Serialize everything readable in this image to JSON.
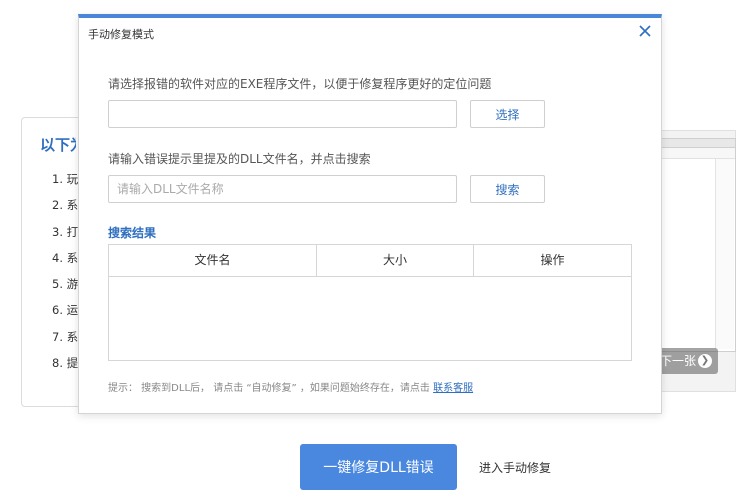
{
  "background": {
    "card_title": "以下为",
    "list_items": [
      "1. 玩",
      "2. 系",
      "3. 打",
      "4. 系",
      "5. 游",
      "6. 运",
      "7. 系",
      "8. 提"
    ],
    "next_button": "下一张",
    "primary_button": "一键修复DLL错误",
    "manual_link": "进入手动修复"
  },
  "modal": {
    "title": "手动修复模式",
    "exe_label": "请选择报错的软件对应的EXE程序文件，以便于修复程序更好的定位问题",
    "exe_value": "",
    "select_button": "选择",
    "dll_label": "请输入错误提示里提及的DLL文件名，并点击搜索",
    "dll_placeholder": "请输入DLL文件名称",
    "search_button": "搜索",
    "results_title": "搜索结果",
    "columns": [
      "文件名",
      "大小",
      "操作"
    ],
    "tip_text": "提示：  搜索到DLL后，  请点击  “自动修复”  ，如果问题始终存在，请点击",
    "tip_link": "联系客服"
  },
  "colors": {
    "accent": "#4a86d8",
    "link": "#2f6fbf"
  }
}
